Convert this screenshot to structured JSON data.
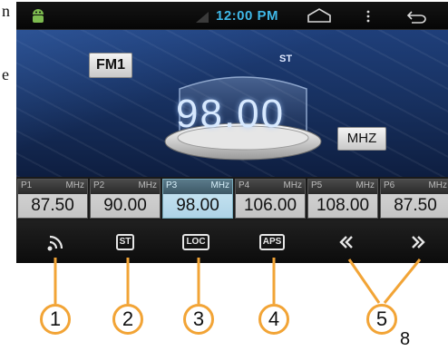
{
  "page_fragments": {
    "left_top": "n",
    "left_mid": "e",
    "page_number": "8"
  },
  "status_bar": {
    "time": "12:00 PM",
    "icons": [
      "android-notification-icon",
      "signal-icon",
      "home-icon",
      "menu-icon",
      "back-icon"
    ]
  },
  "radio": {
    "band": "FM1",
    "stereo_indicator": "ST",
    "frequency": "98.00",
    "unit": "MHZ"
  },
  "presets": [
    {
      "label": "P1",
      "unit": "MHz",
      "value": "87.50",
      "active": false
    },
    {
      "label": "P2",
      "unit": "MHz",
      "value": "90.00",
      "active": false
    },
    {
      "label": "P3",
      "unit": "MHz",
      "value": "98.00",
      "active": true
    },
    {
      "label": "P4",
      "unit": "MHz",
      "value": "106.00",
      "active": false
    },
    {
      "label": "P5",
      "unit": "MHz",
      "value": "108.00",
      "active": false
    },
    {
      "label": "P6",
      "unit": "MHz",
      "value": "87.50",
      "active": false
    }
  ],
  "controls": {
    "st": "ST",
    "loc": "LOC",
    "aps": "APS",
    "seek_back_icon": "double-chevron-left-icon",
    "seek_forward_icon": "double-chevron-right-icon",
    "band_icon": "signal-arc-icon"
  },
  "callouts": [
    "1",
    "2",
    "3",
    "4",
    "5"
  ],
  "colors": {
    "callout": "#f2a436",
    "time": "#3fb8e8",
    "screen_bg": "#1f3f7a"
  }
}
